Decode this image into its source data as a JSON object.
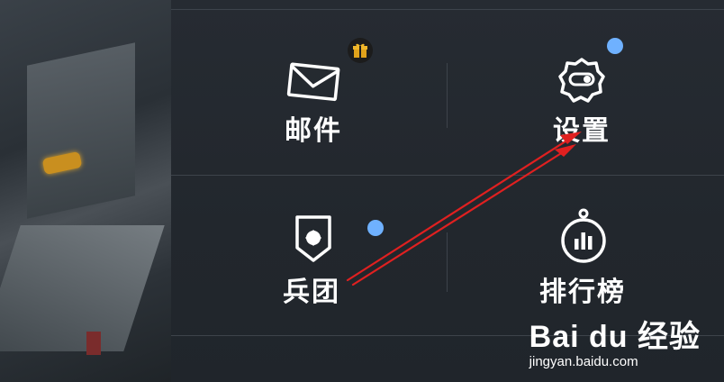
{
  "menu": {
    "mail": {
      "label": "邮件",
      "icon": "mail-icon",
      "badge_icon": "gift-icon"
    },
    "settings": {
      "label": "设置",
      "icon": "gear-toggle-icon"
    },
    "legion": {
      "label": "兵团",
      "icon": "legion-shield-icon"
    },
    "leaderboard": {
      "label": "排行榜",
      "icon": "stopwatch-chart-icon"
    }
  },
  "watermark": {
    "logo": "Bai du 经验",
    "url": "jingyan.baidu.com"
  },
  "colors": {
    "panel_bg": "#252a31",
    "notification_dot": "#6fb1ff",
    "gift_badge": "#e0a21b",
    "annotation_arrow": "#e02020"
  }
}
